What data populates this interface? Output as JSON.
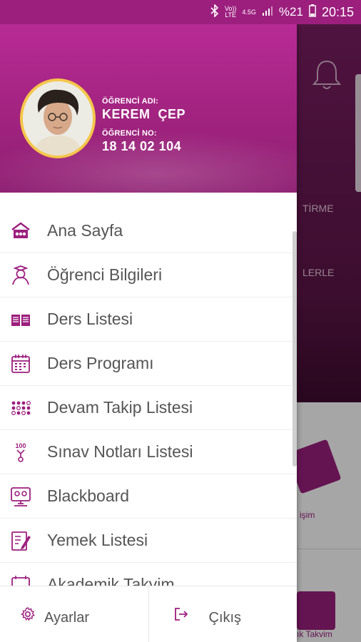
{
  "status_bar": {
    "volte": "Vo))",
    "lte": "LTE",
    "network": "4.5G",
    "battery_percent": "%21",
    "time": "20:15"
  },
  "background": {
    "label_1": "TİRME",
    "label_2": "LERLE",
    "card_label_1": "işim",
    "card_label_2": "ık Takvim"
  },
  "profile": {
    "name_caption": "ÖĞRENCİ ADI:",
    "name": "KEREM  ÇEP",
    "number_caption": "ÖĞRENCİ NO:",
    "number": "18 14 02 104"
  },
  "menu": {
    "items": [
      {
        "label": "Ana Sayfa",
        "icon": "home-icon"
      },
      {
        "label": "Öğrenci Bilgileri",
        "icon": "student-icon"
      },
      {
        "label": "Ders Listesi",
        "icon": "book-icon"
      },
      {
        "label": "Ders Programı",
        "icon": "calendar-icon"
      },
      {
        "label": "Devam Takip Listesi",
        "icon": "attendance-icon"
      },
      {
        "label": "Sınav Notları Listesi",
        "icon": "grade-icon"
      },
      {
        "label": "Blackboard",
        "icon": "monitor-icon"
      },
      {
        "label": "Yemek Listesi",
        "icon": "menu-list-icon"
      },
      {
        "label": "Akademik Takvim",
        "icon": "calendar-icon"
      }
    ]
  },
  "footer": {
    "settings_label": "Ayarlar",
    "logout_label": "Çıkış"
  },
  "colors": {
    "primary": "#9c1f7e",
    "header": "#a1237f",
    "avatar_ring": "#f5c64a"
  }
}
